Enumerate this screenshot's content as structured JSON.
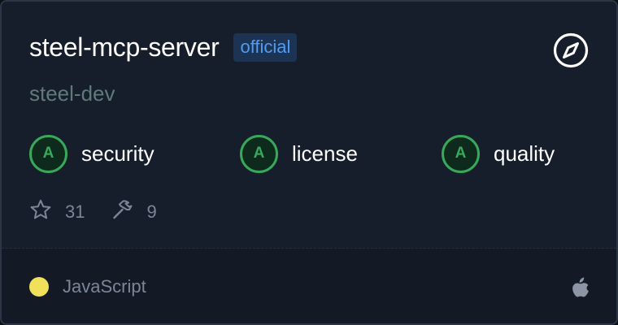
{
  "server": {
    "name": "steel-mcp-server",
    "badge": "official",
    "owner": "steel-dev"
  },
  "header": {
    "action_icon": "compass-icon"
  },
  "scores": [
    {
      "grade": "A",
      "label": "security"
    },
    {
      "grade": "A",
      "label": "license"
    },
    {
      "grade": "A",
      "label": "quality"
    }
  ],
  "stats": {
    "stars": "31",
    "tools": "9",
    "stars_icon": "star-icon",
    "tools_icon": "hammer-icon"
  },
  "footer": {
    "language": "JavaScript",
    "language_color": "#f1e05a",
    "platform_icon": "apple-icon"
  },
  "colors": {
    "card_background": "#161d2b",
    "badge_background": "#1c3354",
    "badge_text": "#4f9cf0",
    "grade_green": "#38a85b",
    "owner_text": "#5f7a78"
  }
}
